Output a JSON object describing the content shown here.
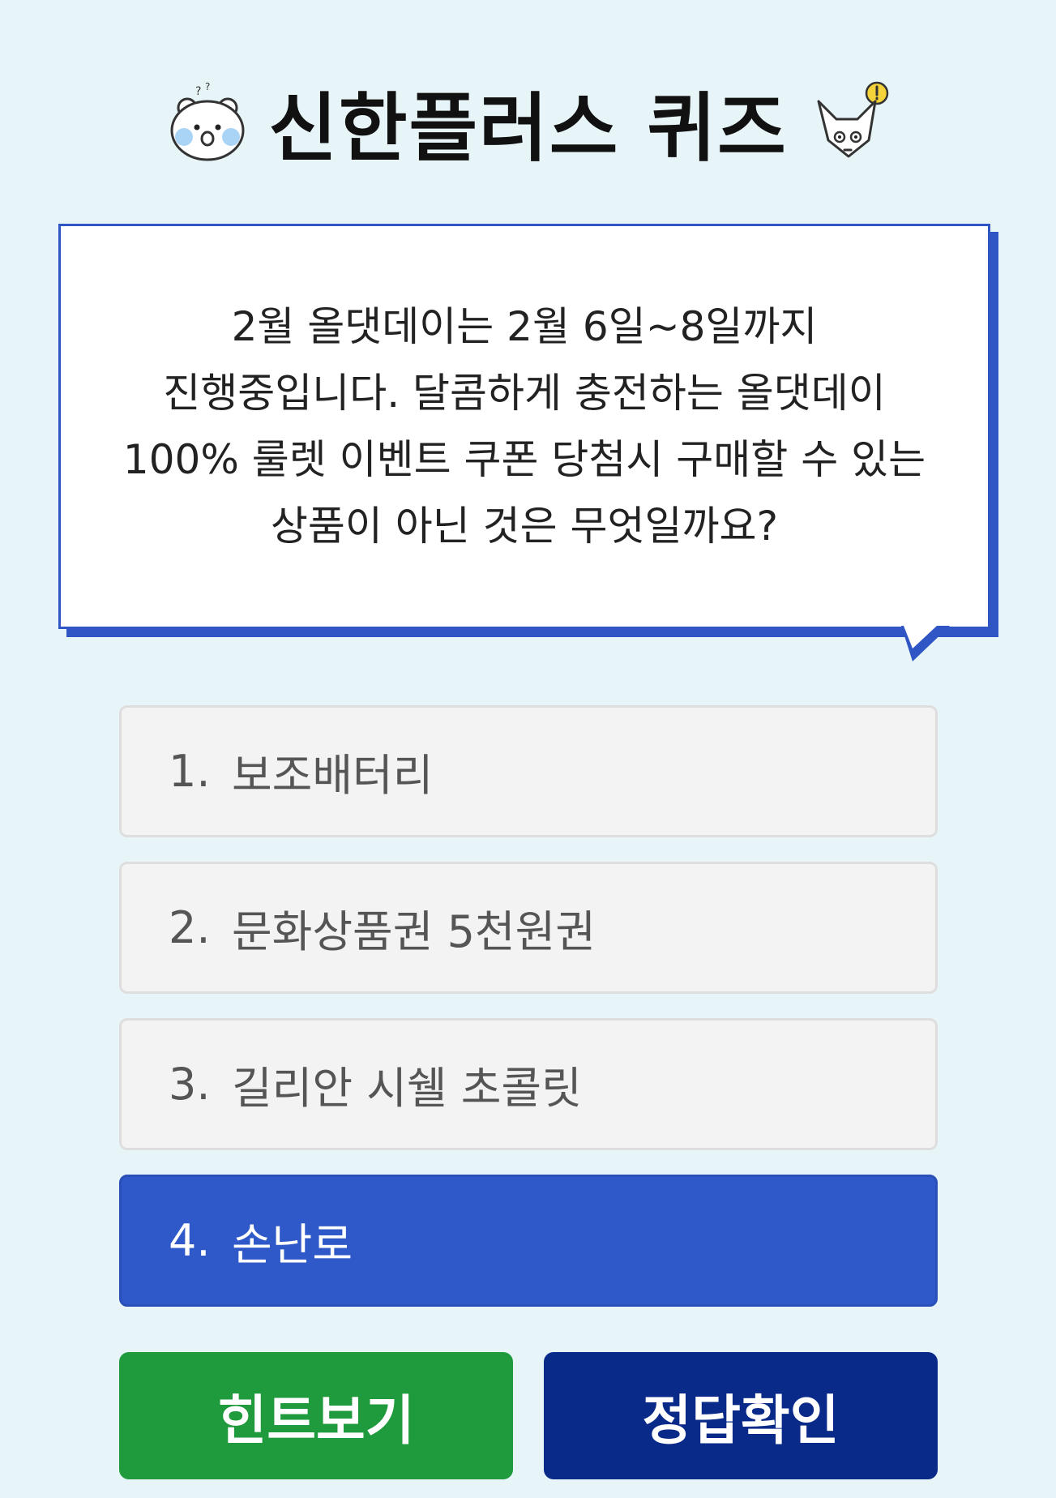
{
  "header": {
    "title": "신한플러스 퀴즈",
    "left_mascot_icon": "bear-mascot-icon",
    "right_mascot_icon": "fox-mascot-icon"
  },
  "question": {
    "text": "2월 올댓데이는 2월 6일~8일까지\n진행중입니다. 달콤하게 충전하는 올댓데이\n100% 룰렛 이벤트 쿠폰 당첨시 구매할 수 있는\n상품이 아닌 것은 무엇일까요?"
  },
  "options": [
    {
      "num": "1.",
      "label": "보조배터리",
      "selected": false
    },
    {
      "num": "2.",
      "label": "문화상품권 5천원권",
      "selected": false
    },
    {
      "num": "3.",
      "label": "길리안 시쉘 초콜릿",
      "selected": false
    },
    {
      "num": "4.",
      "label": "손난로",
      "selected": true
    }
  ],
  "buttons": {
    "hint_label": "힌트보기",
    "answer_label": "정답확인"
  },
  "colors": {
    "background": "#e8f5f8",
    "accent_blue": "#2f58c8",
    "hint_green": "#1f9a3c",
    "answer_navy": "#0a2a8a"
  }
}
